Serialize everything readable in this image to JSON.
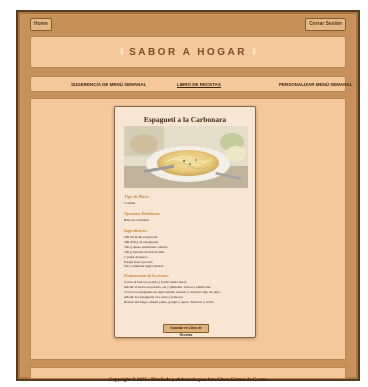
{
  "topbar": {
    "home_label": "Home",
    "logout_label": "Cerrar Sesión"
  },
  "header": {
    "ornament_left": "‖",
    "ornament_right": "‖",
    "title": "SABOR A HOGAR"
  },
  "nav": {
    "items": [
      {
        "label": "SUGERENCIA DE MENÚ SEMANAL"
      },
      {
        "label": "LIBRO DE RECETAS"
      },
      {
        "label": "PERSONALIZAR MENÚ SEMANAL"
      }
    ]
  },
  "recipe": {
    "title": "Espagueti a la Carbonara",
    "image_alt": "plato de espagueti a la carbonara",
    "dish_type_heading": "Tipo de Plato:",
    "dish_type": "Comida",
    "cuisine_heading": "Opciones Dietéticas:",
    "cuisine": "Bajo en colesterol",
    "ingredients_heading": "Ingredientes:",
    "ingredients": [
      "200 ml leche evaporada",
      "300-350 g de espaguetis",
      "100 g queso parmesano rallado",
      "100 g lonchas de beicon fino",
      "1 yema de huevo",
      "Perejil fresco picado",
      "Sal y pimienta negra molida"
    ],
    "preparation_heading": "Preparación de la receta:",
    "preparation": [
      "Cortar el beicon en tiras y freírlo hasta dorar.",
      "Añadir la leche evaporada, sal y pimienta. Llevar a ebullición.",
      "Cocer los espaguetis en agua salada, escurrir y reservar algo de agua.",
      "Añadir los espaguetis a la salsa y remover.",
      "Retirar del fuego, añadir yema, perejil y queso. Mezclar y servir."
    ],
    "add_button": "Guardar en Libro de Recetas"
  },
  "footer": {
    "text": "Copyright © 2025 - Diseñado y elaborado por Ana Clara Gómez de Castro"
  },
  "colors": {
    "frame": "#c79259",
    "panel": "#f4c89a",
    "card": "#f7e6d4",
    "accent": "#c9873f"
  }
}
